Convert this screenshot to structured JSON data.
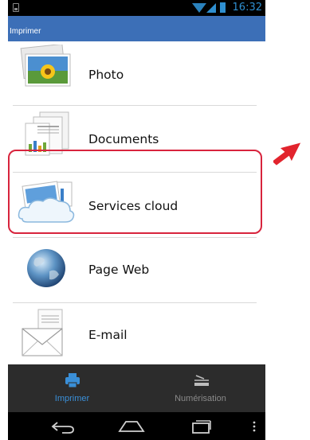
{
  "status_bar": {
    "time": "16:32"
  },
  "action_bar": {
    "title": "Imprimer"
  },
  "list": {
    "items": [
      {
        "label": "Photo",
        "icon": "photo-icon"
      },
      {
        "label": "Documents",
        "icon": "documents-icon"
      },
      {
        "label": "Services cloud",
        "icon": "cloud-services-icon"
      },
      {
        "label": "Page Web",
        "icon": "globe-icon"
      },
      {
        "label": "E-mail",
        "icon": "email-icon"
      }
    ]
  },
  "tabs": [
    {
      "label": "Imprimer",
      "icon": "printer-icon",
      "active": true
    },
    {
      "label": "Numérisation",
      "icon": "scanner-icon",
      "active": false
    }
  ],
  "colors": {
    "accent": "#3c6fb7",
    "highlight": "#d8243d",
    "status_text": "#2f8fd0",
    "active_tab": "#3a8fd8",
    "inactive_tab": "#8a8a8a"
  }
}
